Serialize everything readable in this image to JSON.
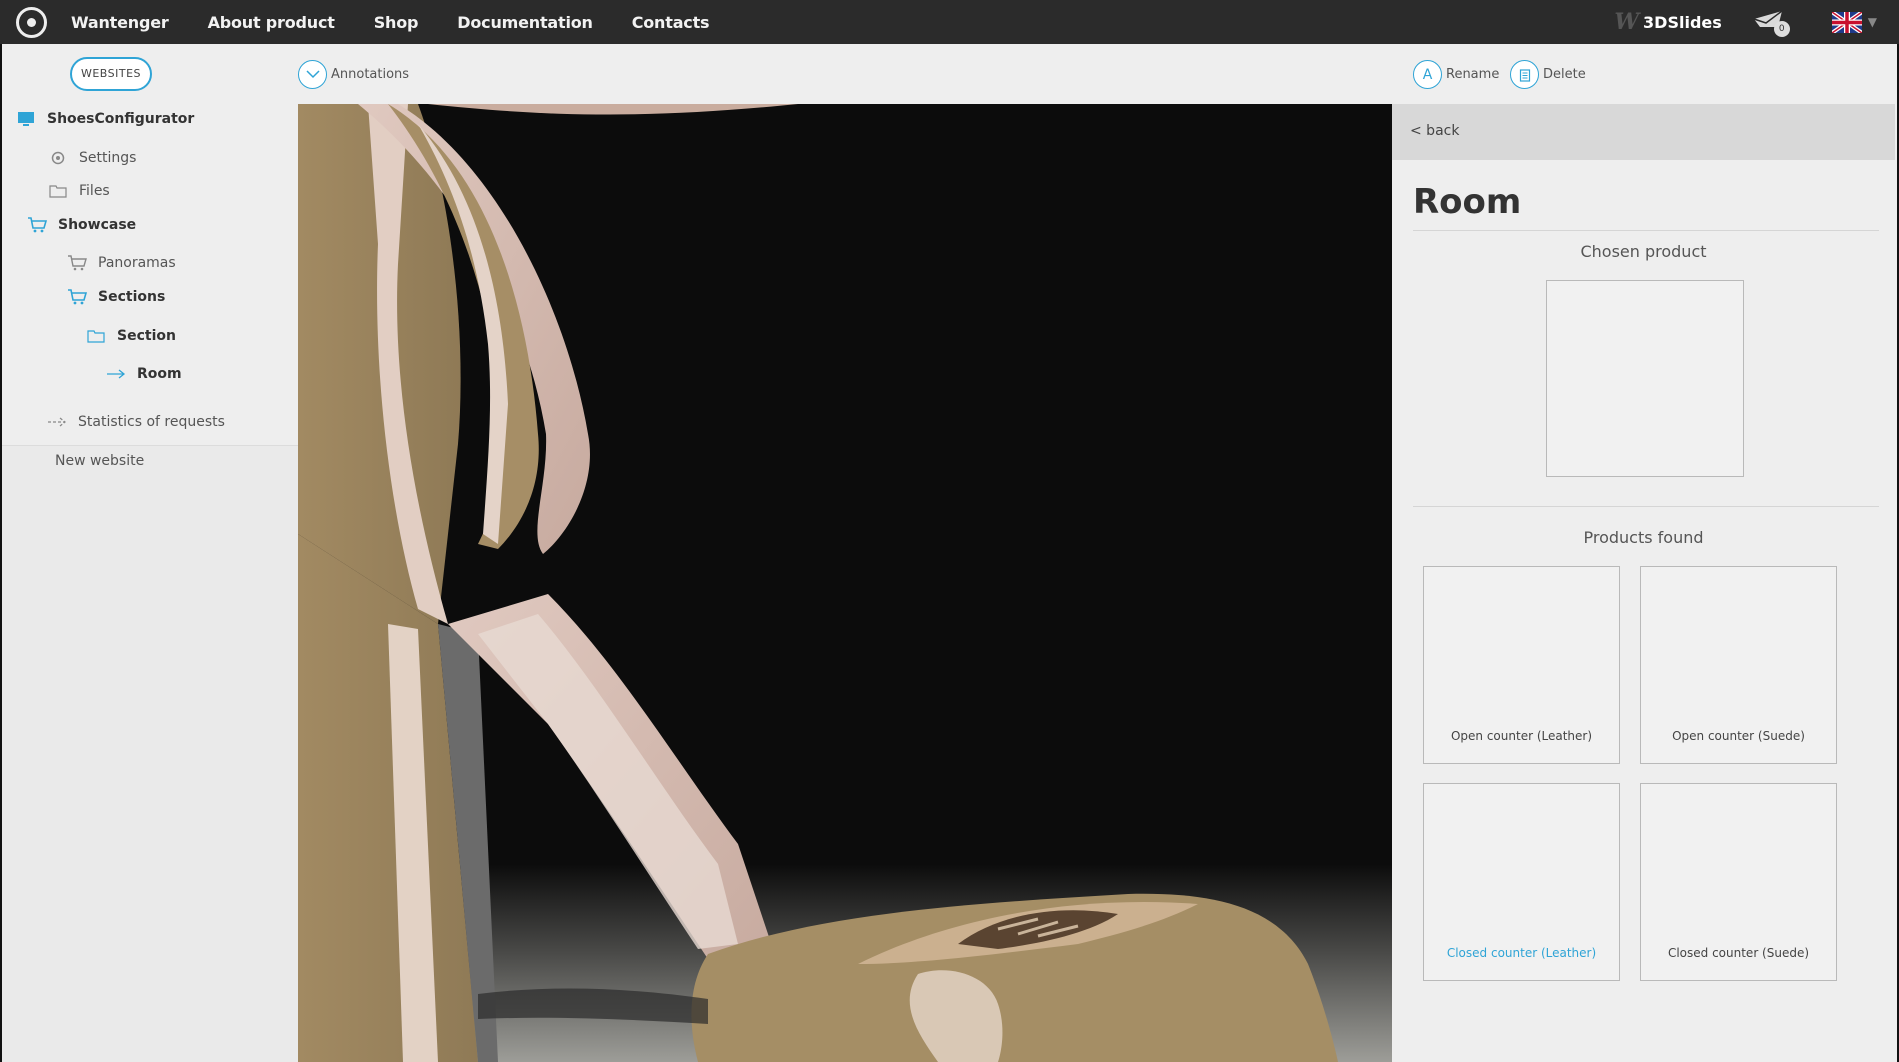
{
  "topbar": {
    "logo_icon": "wantenger-logo-icon",
    "nav": [
      "Wantenger",
      "About product",
      "Shop",
      "Documentation",
      "Contacts"
    ],
    "brand_name": "3DSlides",
    "brand_icon": "3dslides-w-icon",
    "cart_icon": "cart-icon",
    "cart_count": "0",
    "language_icon": "uk-flag-icon",
    "language_caret": "▼"
  },
  "sidebar": {
    "websites_button": "WEBSITES",
    "site_name": "ShoesConfigurator",
    "items": {
      "settings": "Settings",
      "files": "Files",
      "showcase": "Showcase",
      "panoramas": "Panoramas",
      "sections": "Sections",
      "section": "Section",
      "room": "Room",
      "statistics": "Statistics of requests"
    },
    "new_website": "New website"
  },
  "toolbar": {
    "annotations_label": "Annotations",
    "rename_label": "Rename",
    "rename_icon_letter": "A",
    "delete_label": "Delete"
  },
  "panel": {
    "back_label": "< back",
    "title": "Room",
    "chosen_heading": "Chosen product",
    "found_heading": "Products found",
    "products": [
      {
        "label": "Open counter (Leather)"
      },
      {
        "label": "Open counter (Suede)"
      },
      {
        "label": "Closed counter (Leather)"
      },
      {
        "label": "Closed counter (Suede)"
      }
    ]
  },
  "colors": {
    "accent": "#2fa4d6",
    "topbar": "#2b2b2b",
    "background": "#eeeeee"
  }
}
